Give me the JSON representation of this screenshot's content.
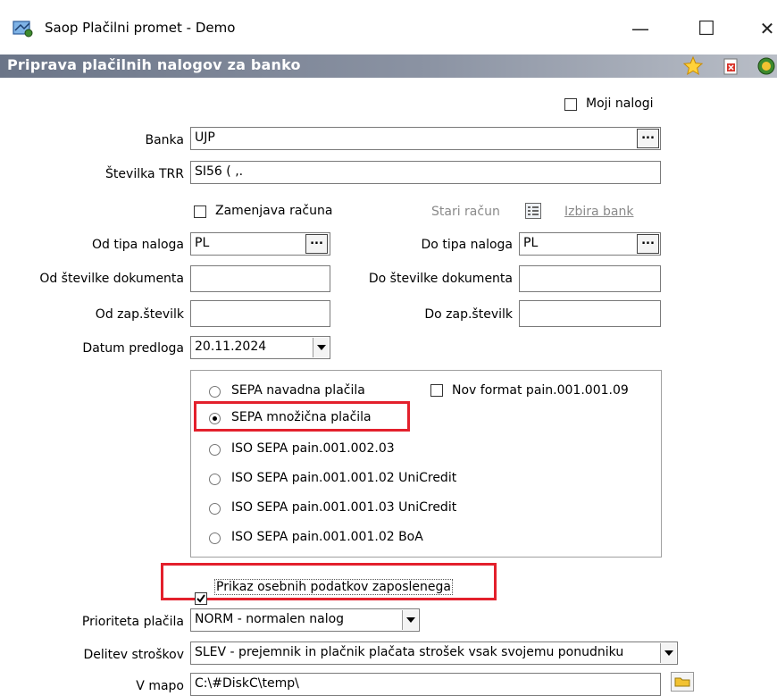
{
  "window": {
    "title": "Saop Plačilni promet - Demo",
    "minimize": "—",
    "maximize": "☐",
    "close": "✕"
  },
  "header": {
    "title": "Priprava plačilnih nalogov za banko",
    "icons": [
      "star-icon",
      "delete-document-icon",
      "exit-icon"
    ]
  },
  "form": {
    "moji_nalogi": {
      "label": "Moji nalogi",
      "checked": false
    },
    "banka": {
      "label": "Banka",
      "value": "UJP"
    },
    "stevilka_trr": {
      "label": "Številka TRR",
      "value": "SI56 (           ,."
    },
    "zamenjava": {
      "label": "Zamenjava računa",
      "checked": false
    },
    "stari_racun": "Stari račun",
    "izbira_bank": "Izbira bank",
    "od_tipa": {
      "label": "Od tipa naloga",
      "value": "PL"
    },
    "do_tipa": {
      "label": "Do tipa naloga",
      "value": "PL"
    },
    "od_st_dok": {
      "label": "Od številke dokumenta",
      "value": ""
    },
    "do_st_dok": {
      "label": "Do številke dokumenta",
      "value": ""
    },
    "od_zap": {
      "label": "Od zap.številk",
      "value": ""
    },
    "do_zap": {
      "label": "Do zap.številk",
      "value": ""
    },
    "datum": {
      "label": "Datum predloga",
      "value": "20.11.2024"
    },
    "format_options": [
      {
        "label": "SEPA navadna plačila",
        "selected": false
      },
      {
        "label": "SEPA množična plačila",
        "selected": true
      },
      {
        "label": "ISO SEPA pain.001.002.03",
        "selected": false
      },
      {
        "label": "ISO SEPA pain.001.001.02 UniCredit",
        "selected": false
      },
      {
        "label": "ISO SEPA pain.001.001.03 UniCredit",
        "selected": false
      },
      {
        "label": "ISO SEPA pain.001.001.02 BoA",
        "selected": false
      }
    ],
    "nov_format": {
      "label": "Nov format pain.001.001.09",
      "checked": false
    },
    "prikaz": {
      "label": "Prikaz osebnih podatkov zaposlenega",
      "checked": true
    },
    "prioriteta": {
      "label": "Prioriteta plačila",
      "value": "NORM - normalen nalog"
    },
    "delitev": {
      "label": "Delitev stroškov",
      "value": "SLEV - prejemnik in plačnik plačata strošek vsak svojemu ponudniku"
    },
    "v_mapo": {
      "label": "V mapo",
      "value": "C:\\#DiskC\\temp\\"
    }
  },
  "colors": {
    "highlight": "#e3202c",
    "header_dark": "#6b7588"
  }
}
